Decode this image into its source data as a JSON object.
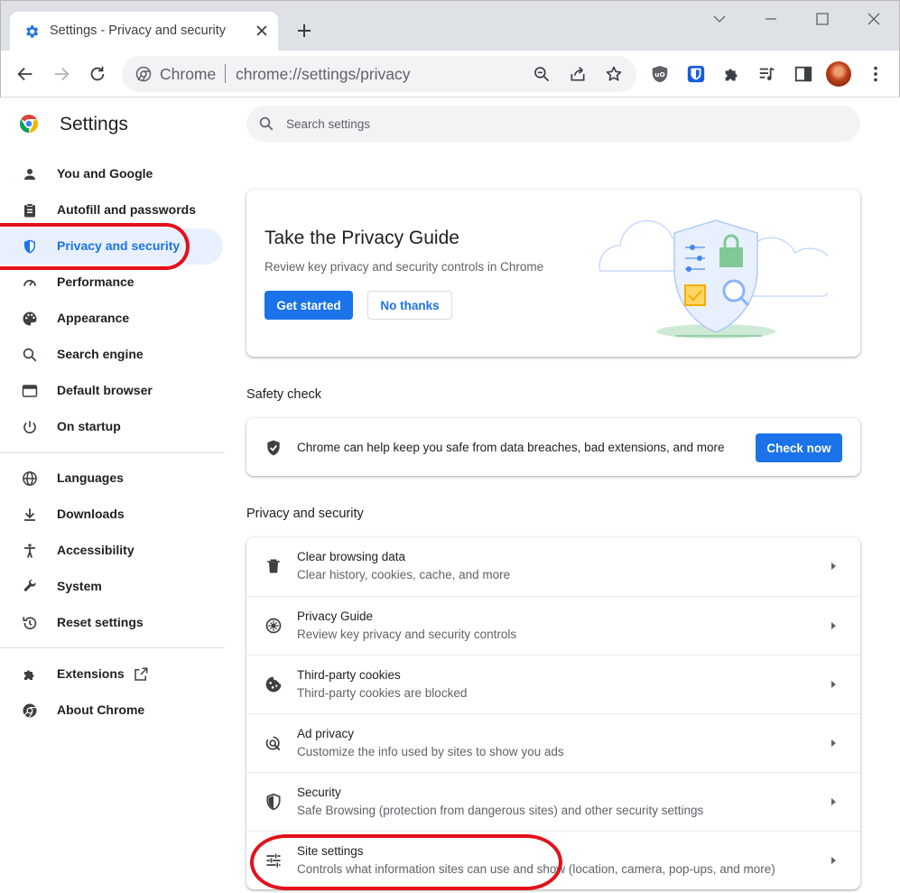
{
  "colors": {
    "accent": "#1a73e8",
    "annotation": "#e3101a",
    "active_nav_bg": "#e8f0fe"
  },
  "browser": {
    "tab": {
      "title": "Settings - Privacy and security",
      "favicon": "gear-icon"
    },
    "omnibox": {
      "host": "Chrome",
      "url": "chrome://settings/privacy"
    }
  },
  "sidebar": {
    "title": "Settings",
    "items": [
      {
        "label": "You and Google",
        "icon": "person-icon"
      },
      {
        "label": "Autofill and passwords",
        "icon": "clipboard-icon"
      },
      {
        "label": "Privacy and security",
        "icon": "shield-icon",
        "active": true
      },
      {
        "label": "Performance",
        "icon": "speedometer-icon"
      },
      {
        "label": "Appearance",
        "icon": "palette-icon"
      },
      {
        "label": "Search engine",
        "icon": "search-icon"
      },
      {
        "label": "Default browser",
        "icon": "browser-window-icon"
      },
      {
        "label": "On startup",
        "icon": "power-icon"
      },
      {
        "label": "Languages",
        "icon": "globe-icon"
      },
      {
        "label": "Downloads",
        "icon": "download-icon"
      },
      {
        "label": "Accessibility",
        "icon": "accessibility-icon"
      },
      {
        "label": "System",
        "icon": "wrench-icon"
      },
      {
        "label": "Reset settings",
        "icon": "reset-history-icon"
      },
      {
        "label": "Extensions",
        "icon": "puzzle-icon"
      },
      {
        "label": "About Chrome",
        "icon": "chrome-logo-icon"
      }
    ]
  },
  "search": {
    "placeholder": "Search settings"
  },
  "privacy_guide": {
    "title": "Take the Privacy Guide",
    "description": "Review key privacy and security controls in Chrome",
    "primary_button": "Get started",
    "secondary_button": "No thanks"
  },
  "safety_check": {
    "section_title": "Safety check",
    "text": "Chrome can help keep you safe from data breaches, bad extensions, and more",
    "button": "Check now"
  },
  "privacy_section": {
    "section_title": "Privacy and security",
    "rows": [
      {
        "title": "Clear browsing data",
        "subtitle": "Clear history, cookies, cache, and more",
        "icon": "trash-icon"
      },
      {
        "title": "Privacy Guide",
        "subtitle": "Review key privacy and security controls",
        "icon": "compass-icon"
      },
      {
        "title": "Third-party cookies",
        "subtitle": "Third-party cookies are blocked",
        "icon": "cookie-icon"
      },
      {
        "title": "Ad privacy",
        "subtitle": "Customize the info used by sites to show you ads",
        "icon": "ad-privacy-icon"
      },
      {
        "title": "Security",
        "subtitle": "Safe Browsing (protection from dangerous sites) and other security settings",
        "icon": "shield-icon"
      },
      {
        "title": "Site settings",
        "subtitle": "Controls what information sites can use and show (location, camera, pop-ups, and more)",
        "icon": "sliders-icon"
      }
    ]
  }
}
